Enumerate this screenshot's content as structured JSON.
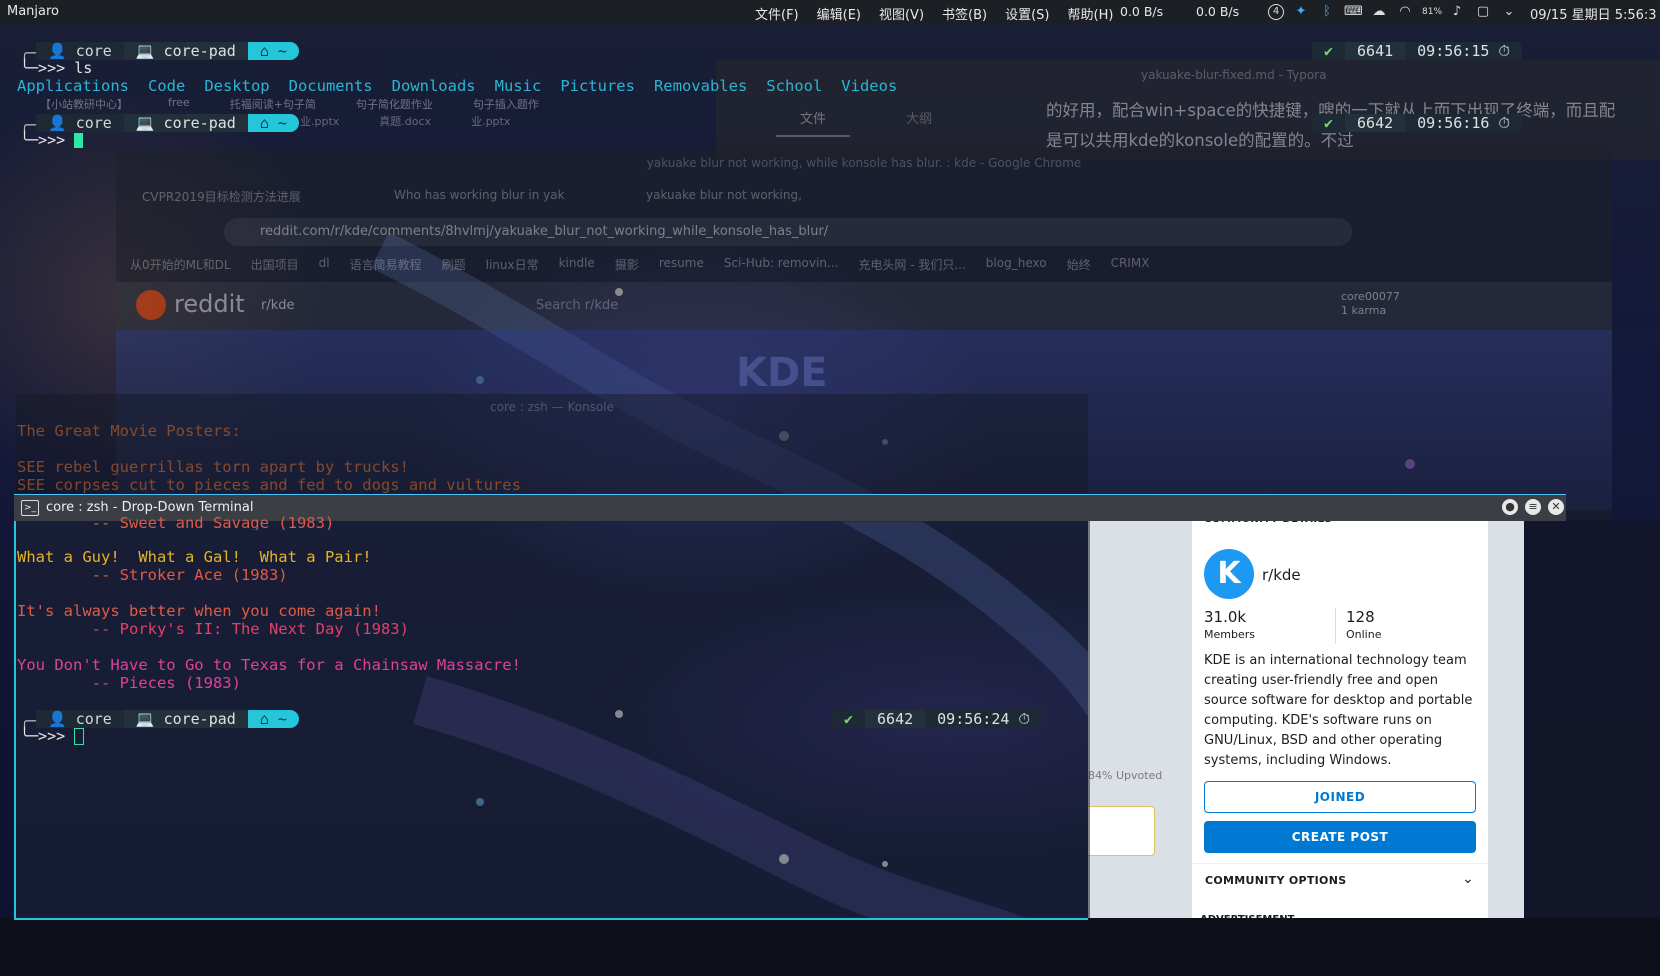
{
  "top_panel": {
    "distro": "Manjaro",
    "menu": [
      "文件(F)",
      "编辑(E)",
      "视图(V)",
      "书签(B)",
      "设置(S)",
      "帮助(H)"
    ],
    "net_down": "0.0 B/s",
    "net_up": "0.0 B/s",
    "battery_label": "81%",
    "notifications_count": "4",
    "clock": "09/15 星期日 5:56:3"
  },
  "typora": {
    "title": "yakuake-blur-fixed.md - Typora",
    "tab_files": "文件",
    "tab_outline": "大纲",
    "text_line1": "的好用，配合win+space的快捷键，嗖的一下就从上而下出现了终端，而且配",
    "text_line2": "是可以共用kde的konsole的配置的。不过"
  },
  "chrome": {
    "title": "yakuake blur not working, while konsole has blur. : kde - Google Chrome",
    "tabs": [
      "CVPR2019目标检测方法进展",
      "Who has working blur in yak",
      "yakuake blur not working,"
    ],
    "url": "reddit.com/r/kde/comments/8hvlmj/yakuake_blur_not_working_while_konsole_has_blur/",
    "bookmarks": [
      "从0开始的ML和DL",
      "出国项目",
      "dl",
      "语言简易教程",
      "刷题",
      "linux日常",
      "kindle",
      "摄影",
      "resume",
      "Sci-Hub: removin...",
      "充电头网 - 我们只...",
      "blog_hexo",
      "始终",
      "CRIMX"
    ],
    "reddit_logo": "reddit",
    "subreddit": "r/kde",
    "search_placeholder": "Search r/kde",
    "username": "core00077",
    "karma": "1 karma",
    "banner": "KDE"
  },
  "terminal_top": {
    "prompt1": {
      "user": "core",
      "host": "core-pad",
      "dir": "~",
      "cmd": "ls",
      "ok": "✔",
      "hist": "6641",
      "time": "09:56:15"
    },
    "ls_items": [
      "Applications",
      "Code",
      "Desktop",
      "Documents",
      "Downloads",
      "Music",
      "Pictures",
      "Removables",
      "School",
      "Videos"
    ],
    "desktop_files": [
      "【小站教研中心】",
      "free",
      "托福阅读+句子简",
      "句子简化题作业",
      "句子插入题作",
      "业.pptx",
      "真题.docx",
      "业.pptx"
    ],
    "prompt2": {
      "user": "core",
      "host": "core-pad",
      "dir": "~",
      "ok": "✔",
      "hist": "6642",
      "time": "09:56:16"
    }
  },
  "konsole": {
    "title": "core : zsh — Konsole",
    "line1": "The Great Movie Posters:",
    "line2": "SEE rebel guerrillas torn apart by trucks!",
    "line3": "SEE corpses cut to pieces and fed to dogs and vultures"
  },
  "dropdown": {
    "title": "core : zsh - Drop-Down Terminal",
    "fortune": [
      {
        "text": "        -- Sweet and Savage (1983)",
        "color": "#e05a47"
      },
      {
        "text": "What a Guy!  What a Gal!  What a Pair!",
        "color": "#e6b422"
      },
      {
        "text": "        -- Stroker Ace (1983)",
        "color": "#e05a47"
      },
      {
        "text": "It's always better when you come again!",
        "color": "#e05a47"
      },
      {
        "text": "        -- Porky's II: The Next Day (1983)",
        "color": "#e0406a"
      },
      {
        "text": "You Don't Have to Go to Texas for a Chainsaw Massacre!",
        "color": "#e0409a"
      },
      {
        "text": "        -- Pieces (1983)",
        "color": "#e0409a"
      }
    ],
    "prompt": {
      "user": "core",
      "host": "core-pad",
      "dir": "~",
      "ok": "✔",
      "hist": "6642",
      "time": "09:56:24"
    }
  },
  "reddit_sidebar": {
    "header": "COMMUNITY DETAILS",
    "sub_name": "r/kde",
    "members_count": "31.0k",
    "members_label": "Members",
    "online_count": "128",
    "online_label": "Online",
    "description": "KDE is an international technology team creating user-friendly free and open source software for desktop and portable computing. KDE's software runs on GNU/Linux, BSD and other operating systems, including Windows.",
    "joined_label": "JOINED",
    "create_post_label": "CREATE POST",
    "options_label": "COMMUNITY OPTIONS",
    "ad_label": "ADVERTISEMENT",
    "upvoted": "84% Upvoted"
  }
}
